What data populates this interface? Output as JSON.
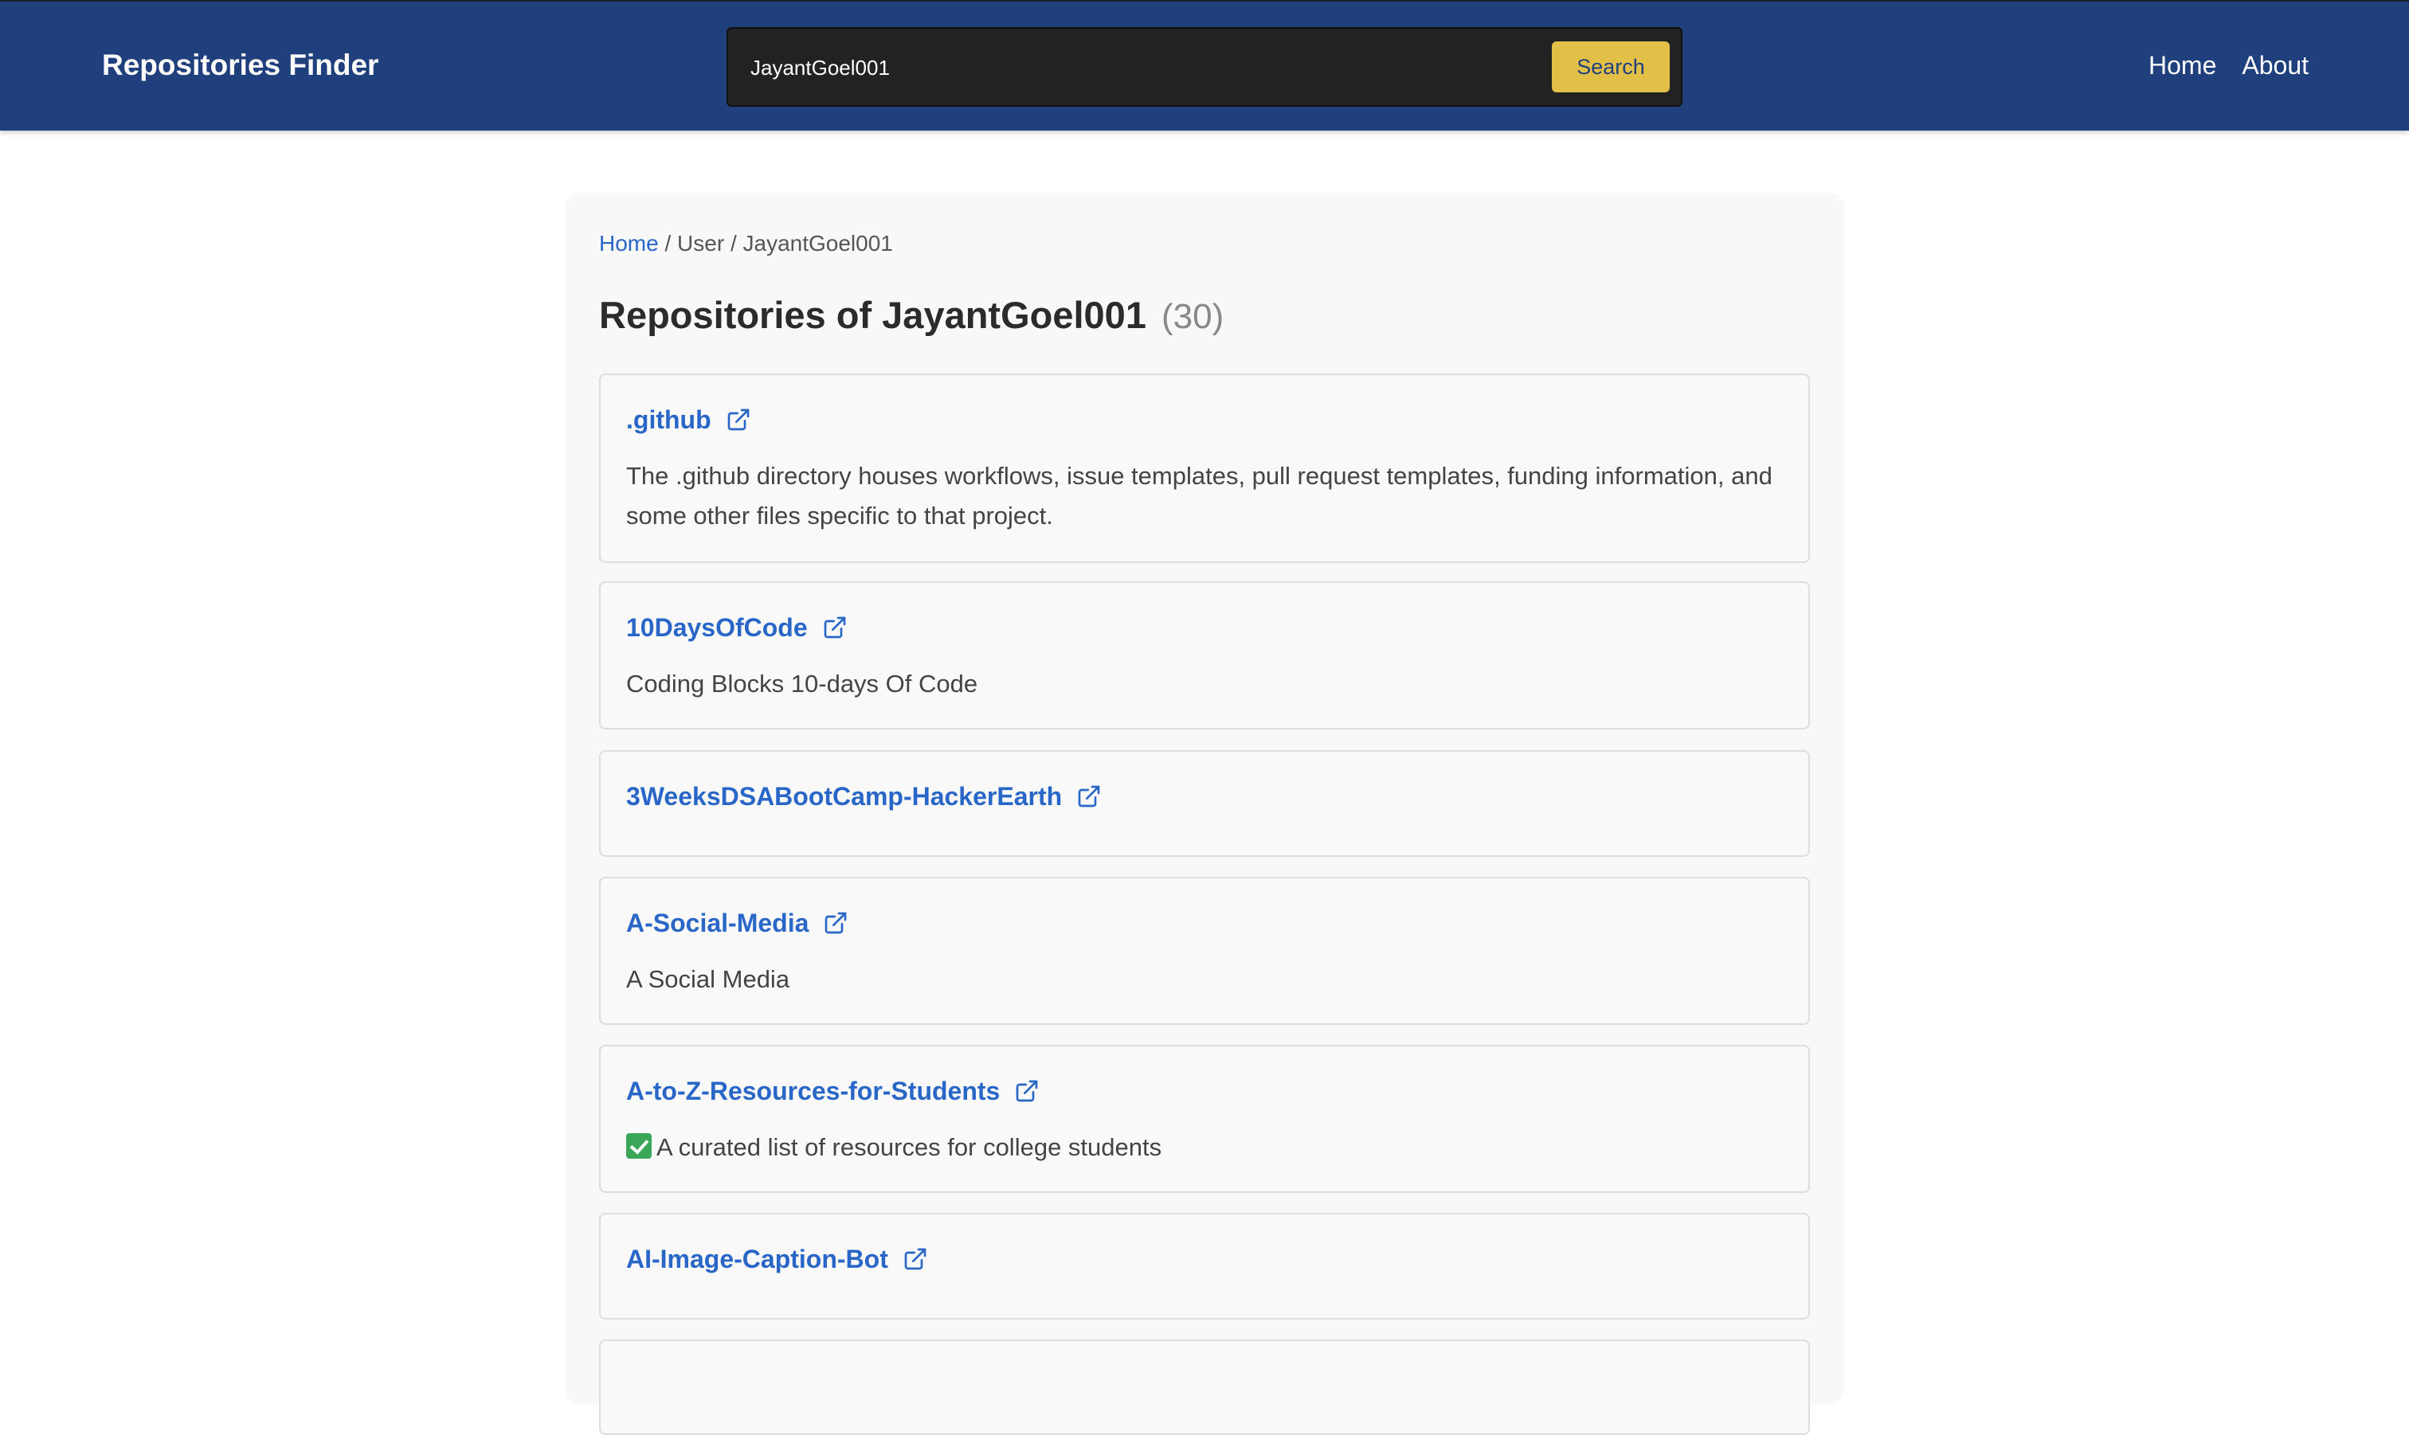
{
  "app": {
    "brand": "Repositories Finder"
  },
  "search": {
    "value": "JayantGoel001",
    "button_label": "Search"
  },
  "nav": {
    "home": "Home",
    "about": "About"
  },
  "breadcrumb": {
    "home": "Home",
    "separator": " / ",
    "user": "User",
    "current": "JayantGoel001"
  },
  "heading": {
    "title": "Repositories of JayantGoel001",
    "count": "(30)"
  },
  "repos": [
    {
      "name": ".github",
      "description": "The .github directory houses workflows, issue templates, pull request templates, funding information, and some other files specific to that project."
    },
    {
      "name": "10DaysOfCode",
      "description": "Coding Blocks 10-days Of Code"
    },
    {
      "name": "3WeeksDSABootCamp-HackerEarth",
      "description": ""
    },
    {
      "name": "A-Social-Media",
      "description": "A Social Media"
    },
    {
      "name": "A-to-Z-Resources-for-Students",
      "description": "A curated list of resources for college students",
      "description_icon": "check-mark-icon"
    },
    {
      "name": "AI-Image-Caption-Bot",
      "description": ""
    },
    {
      "name": "",
      "description": ""
    }
  ],
  "colors": {
    "header_bg": "#203f7d",
    "accent_button": "#e2c048",
    "link": "#2866c7",
    "check_icon": "#3aa657"
  }
}
